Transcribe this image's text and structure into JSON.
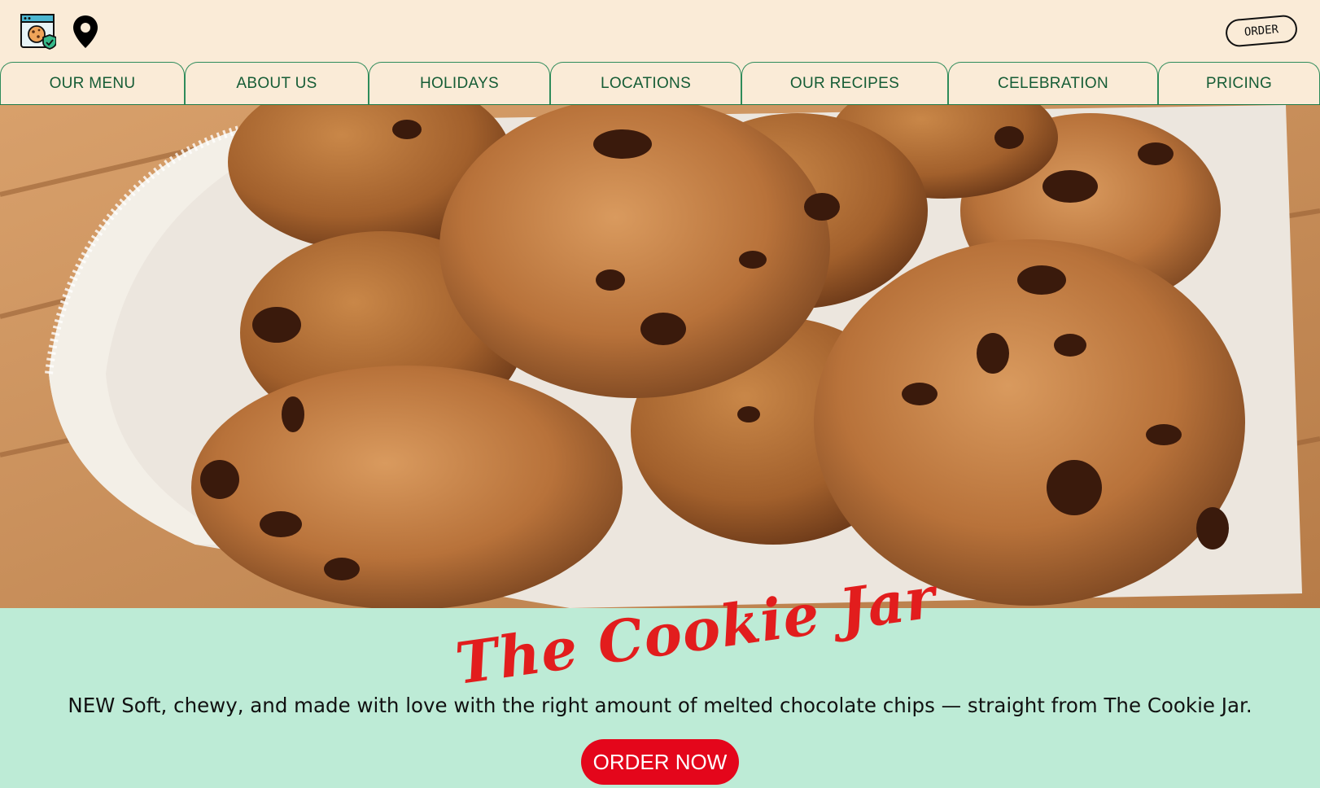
{
  "header": {
    "logo_icon": "cookie-browser-icon",
    "location_icon": "map-pin-icon",
    "order_label": "ORDER"
  },
  "nav": {
    "tabs": [
      {
        "label": "OUR MENU"
      },
      {
        "label": "ABOUT US"
      },
      {
        "label": "HOLIDAYS"
      },
      {
        "label": "LOCATIONS"
      },
      {
        "label": "OUR RECIPES"
      },
      {
        "label": "CELEBRATION"
      },
      {
        "label": "PRICING"
      }
    ]
  },
  "hero": {
    "image": "chocolate-chip-cookies-on-lace-napkin"
  },
  "promo": {
    "brand": "The Cookie Jar",
    "tagline": "NEW Soft, chewy, and made with love with the right amount of melted chocolate chips — straight from The Cookie Jar.",
    "cta_label": "ORDER NOW"
  },
  "colors": {
    "page_bg": "#faebd7",
    "nav_text": "#155c35",
    "nav_border": "#2e8b5a",
    "promo_bg": "#bdebd6",
    "brand_red": "#e21d1d",
    "cta_bg": "#e4061b"
  }
}
